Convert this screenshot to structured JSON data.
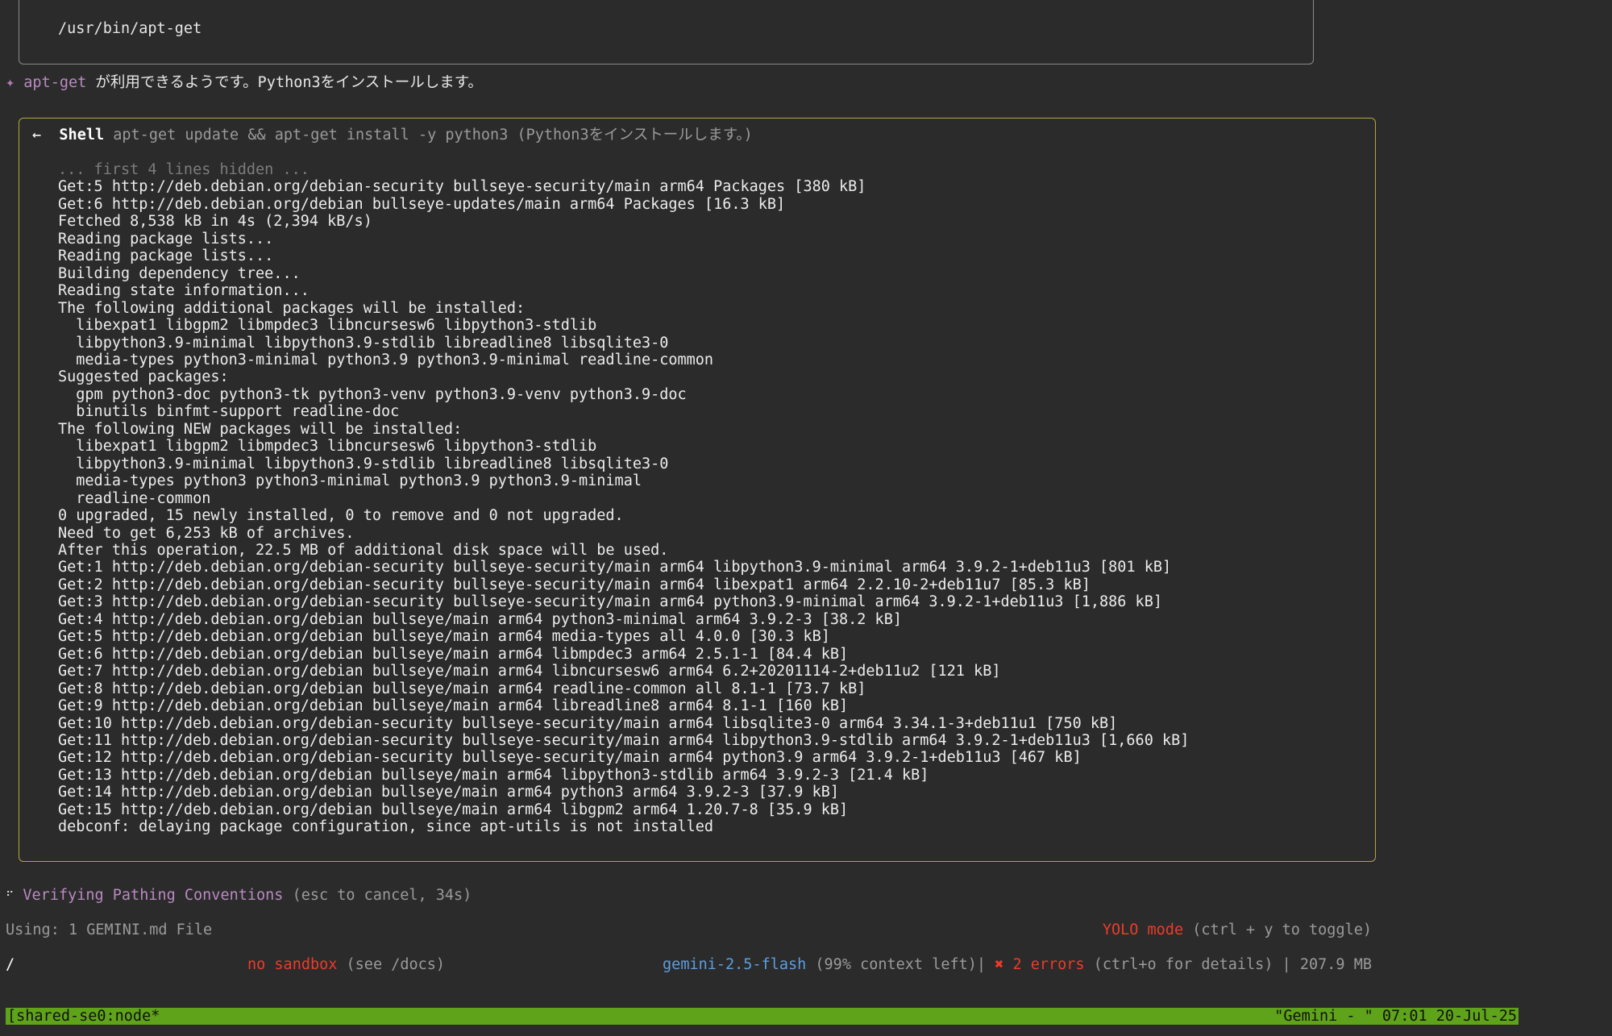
{
  "top_box": {
    "path": "/usr/bin/apt-get"
  },
  "message": {
    "bullet": "✦",
    "command": "apt-get",
    "text": " が利用できるようです。Python3をインストールします。"
  },
  "shell": {
    "arrow_icon": "←",
    "name": "Shell",
    "description": "apt-get update && apt-get install -y python3 (Python3をインストールします。)",
    "hidden_note": "... first 4 lines hidden ...",
    "lines": [
      "Get:5 http://deb.debian.org/debian-security bullseye-security/main arm64 Packages [380 kB]",
      "Get:6 http://deb.debian.org/debian bullseye-updates/main arm64 Packages [16.3 kB]",
      "Fetched 8,538 kB in 4s (2,394 kB/s)",
      "Reading package lists...",
      "Reading package lists...",
      "Building dependency tree...",
      "Reading state information...",
      "The following additional packages will be installed:",
      "  libexpat1 libgpm2 libmpdec3 libncursesw6 libpython3-stdlib",
      "  libpython3.9-minimal libpython3.9-stdlib libreadline8 libsqlite3-0",
      "  media-types python3-minimal python3.9 python3.9-minimal readline-common",
      "Suggested packages:",
      "  gpm python3-doc python3-tk python3-venv python3.9-venv python3.9-doc",
      "  binutils binfmt-support readline-doc",
      "The following NEW packages will be installed:",
      "  libexpat1 libgpm2 libmpdec3 libncursesw6 libpython3-stdlib",
      "  libpython3.9-minimal libpython3.9-stdlib libreadline8 libsqlite3-0",
      "  media-types python3 python3-minimal python3.9 python3.9-minimal",
      "  readline-common",
      "0 upgraded, 15 newly installed, 0 to remove and 0 not upgraded.",
      "Need to get 6,253 kB of archives.",
      "After this operation, 22.5 MB of additional disk space will be used.",
      "Get:1 http://deb.debian.org/debian-security bullseye-security/main arm64 libpython3.9-minimal arm64 3.9.2-1+deb11u3 [801 kB]",
      "Get:2 http://deb.debian.org/debian-security bullseye-security/main arm64 libexpat1 arm64 2.2.10-2+deb11u7 [85.3 kB]",
      "Get:3 http://deb.debian.org/debian-security bullseye-security/main arm64 python3.9-minimal arm64 3.9.2-1+deb11u3 [1,886 kB]",
      "Get:4 http://deb.debian.org/debian bullseye/main arm64 python3-minimal arm64 3.9.2-3 [38.2 kB]",
      "Get:5 http://deb.debian.org/debian bullseye/main arm64 media-types all 4.0.0 [30.3 kB]",
      "Get:6 http://deb.debian.org/debian bullseye/main arm64 libmpdec3 arm64 2.5.1-1 [84.4 kB]",
      "Get:7 http://deb.debian.org/debian bullseye/main arm64 libncursesw6 arm64 6.2+20201114-2+deb11u2 [121 kB]",
      "Get:8 http://deb.debian.org/debian bullseye/main arm64 readline-common all 8.1-1 [73.7 kB]",
      "Get:9 http://deb.debian.org/debian bullseye/main arm64 libreadline8 arm64 8.1-1 [160 kB]",
      "Get:10 http://deb.debian.org/debian-security bullseye-security/main arm64 libsqlite3-0 arm64 3.34.1-3+deb11u1 [750 kB]",
      "Get:11 http://deb.debian.org/debian-security bullseye-security/main arm64 libpython3.9-stdlib arm64 3.9.2-1+deb11u3 [1,660 kB]",
      "Get:12 http://deb.debian.org/debian-security bullseye-security/main arm64 python3.9 arm64 3.9.2-1+deb11u3 [467 kB]",
      "Get:13 http://deb.debian.org/debian bullseye/main arm64 libpython3-stdlib arm64 3.9.2-3 [21.4 kB]",
      "Get:14 http://deb.debian.org/debian bullseye/main arm64 python3 arm64 3.9.2-3 [37.9 kB]",
      "Get:15 http://deb.debian.org/debian bullseye/main arm64 libgpm2 arm64 1.20.7-8 [35.9 kB]",
      "debconf: delaying package configuration, since apt-utils is not installed"
    ]
  },
  "status": {
    "spinner_icon": "⠋",
    "label": "Verifying Pathing Conventions",
    "hint": "(esc to cancel, 34s)"
  },
  "footer": {
    "using": "Using: 1 GEMINI.md File",
    "yolo_label": "YOLO mode",
    "yolo_hint": "(ctrl + y to toggle)",
    "cwd": "/",
    "sandbox_label": "no sandbox",
    "sandbox_hint": "(see /docs)",
    "model": "gemini-2.5-flash",
    "context": "(99% context left)",
    "separator": "|",
    "error_icon": "✖",
    "errors": "2 errors",
    "errors_hint": "(ctrl+o for details)",
    "memory": "| 207.9 MB"
  },
  "tmux": {
    "left": "[shared-se0:node*",
    "right": "\"Gemini - \" 07:01 20-Jul-25"
  },
  "colors": {
    "background": "#2b2b2b",
    "shell_border": "#b5a53a",
    "accent_purple": "#b98ac0",
    "error_red": "#ef3b2a",
    "model_blue": "#5c9fe0",
    "tmux_green": "#5fa31a"
  }
}
